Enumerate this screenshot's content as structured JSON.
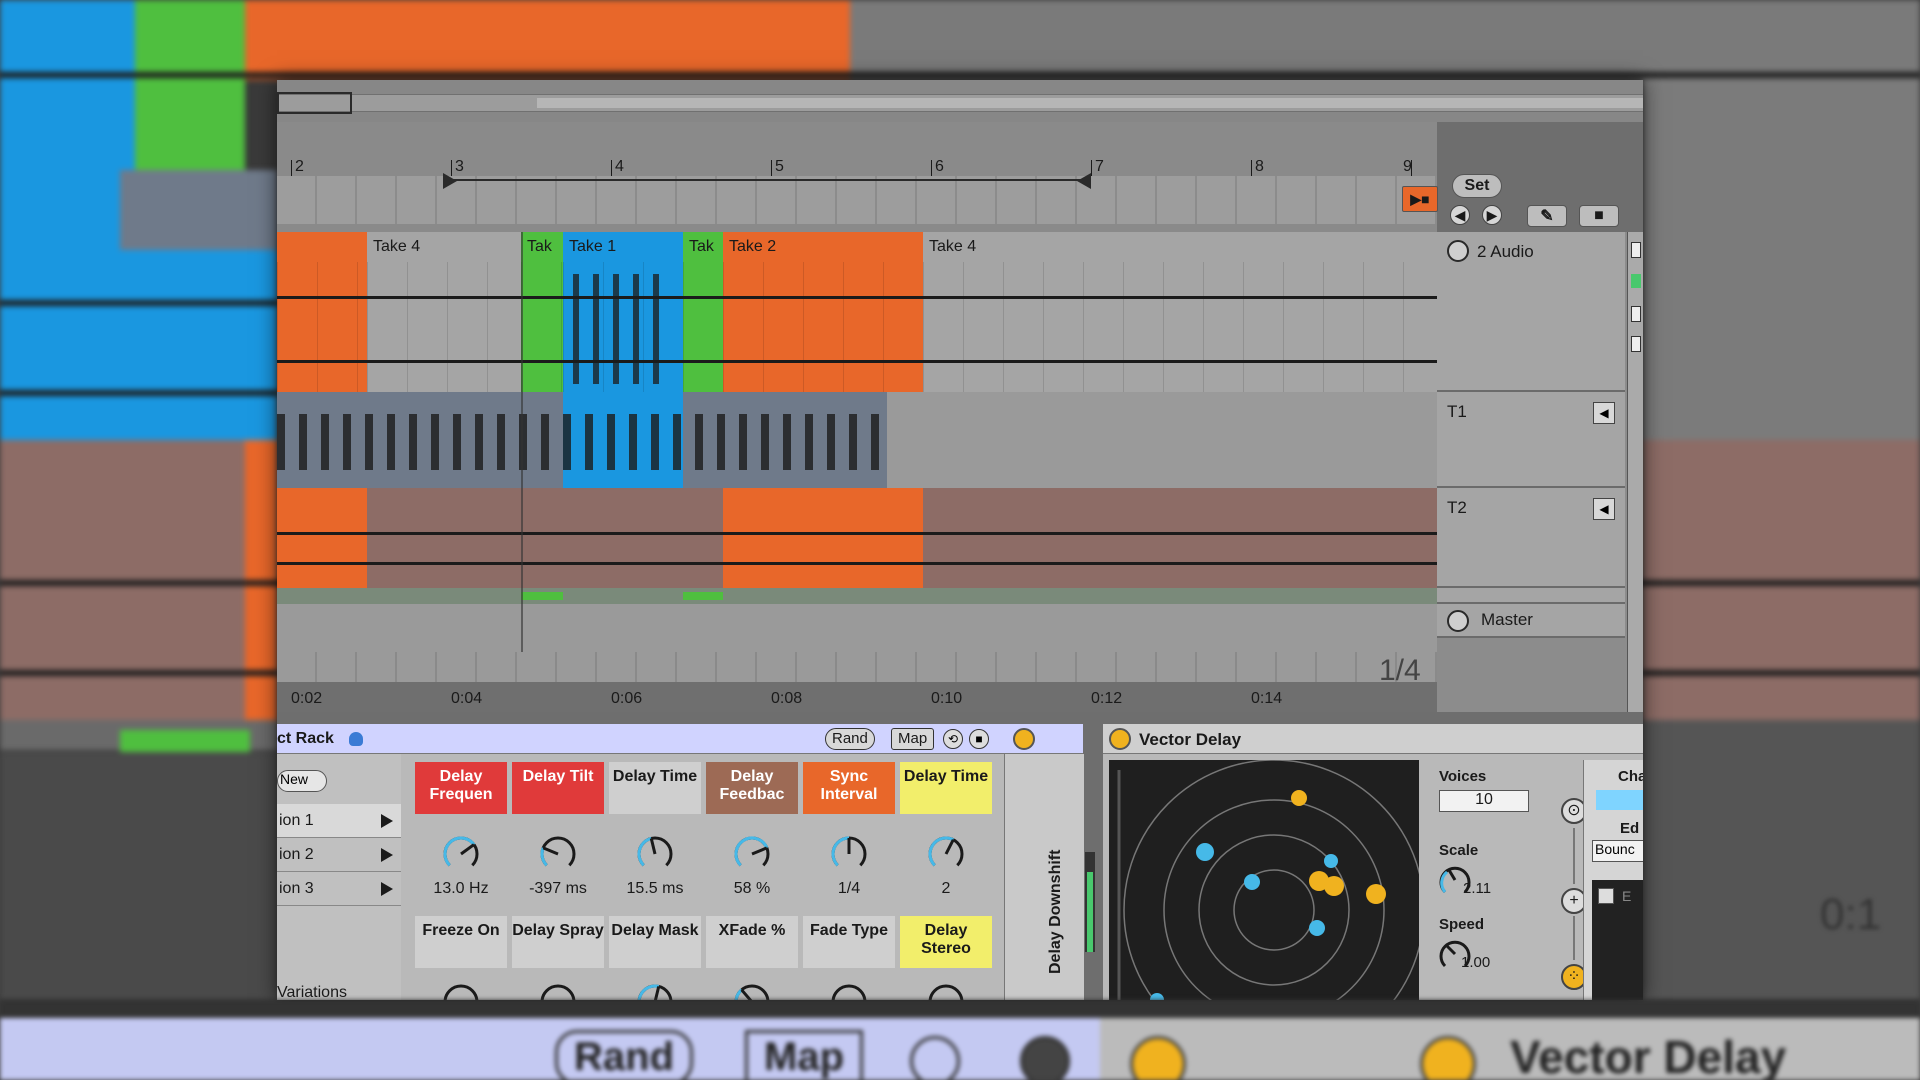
{
  "colors": {
    "orange": "#e8672a",
    "green": "#4fbf3f",
    "blue": "#1a97e0",
    "slate": "#6f7a8a",
    "mauve": "#8d6c66",
    "yellow": "#f2ee6b",
    "red": "#e03a3a"
  },
  "ruler": {
    "bars": [
      "2",
      "3",
      "4",
      "5",
      "6",
      "7",
      "8",
      "9"
    ],
    "set_label": "Set",
    "times": [
      "0:02",
      "0:04",
      "0:06",
      "0:08",
      "0:10",
      "0:12",
      "0:14"
    ],
    "quantize": "1/4"
  },
  "clips": {
    "take4_a": "Take 4",
    "tak_short": "Tak",
    "take1": "Take 1",
    "take2": "Take 2",
    "take4_b": "Take 4"
  },
  "tracks": {
    "audio": "2 Audio",
    "t1": "T1",
    "t2": "T2",
    "master": "Master"
  },
  "rack": {
    "title": "ct Rack",
    "rand_label": "Rand",
    "map_label": "Map",
    "new_label": "New",
    "variations": [
      "ion 1",
      "ion 2",
      "ion 3"
    ],
    "variations_label": "Variations",
    "side_label": "Delay Downshift",
    "macros_top": [
      {
        "label": "Delay Frequen",
        "value": "13.0 Hz"
      },
      {
        "label": "Delay Tilt",
        "value": "-397 ms"
      },
      {
        "label": "Delay Time",
        "value": "15.5 ms"
      },
      {
        "label": "Delay Feedbac",
        "value": "58 %"
      },
      {
        "label": "Sync Interval",
        "value": "1/4"
      },
      {
        "label": "Delay Time",
        "value": "2"
      }
    ],
    "macros_bottom": [
      {
        "label": "Freeze On"
      },
      {
        "label": "Delay Spray"
      },
      {
        "label": "Delay Mask"
      },
      {
        "label": "XFade %"
      },
      {
        "label": "Fade Type"
      },
      {
        "label": "Delay Stereo"
      }
    ]
  },
  "vector_delay": {
    "title": "Vector Delay",
    "voices_label": "Voices",
    "voices_value": "10",
    "scale_label": "Scale",
    "scale_value": "2.11",
    "speed_label": "Speed",
    "speed_value": "1.00",
    "side_label_a": "Cha",
    "side_label_b": "Ed",
    "mode_value": "Bounc",
    "check_label": "E"
  },
  "bottom_blur": {
    "rand": "Rand",
    "map": "Map",
    "title": "Vector Delay",
    "time": "0:1"
  }
}
